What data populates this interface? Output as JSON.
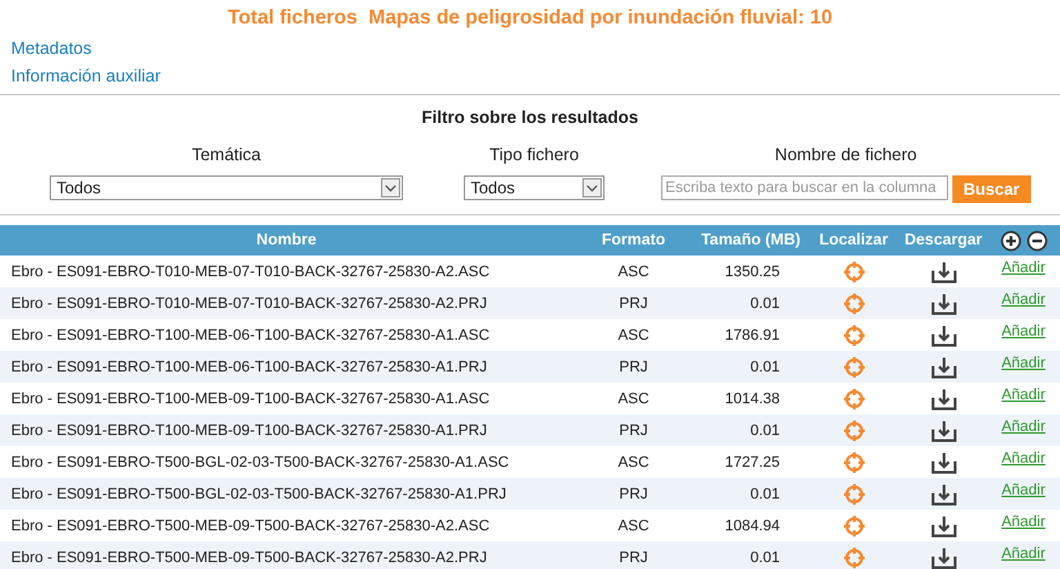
{
  "title": "Total ficheros  Mapas de peligrosidad por inundación fluvial: 10",
  "links": [
    "Metadatos",
    "Información auxiliar"
  ],
  "filter": {
    "title": "Filtro sobre los resultados",
    "fields": [
      {
        "kind": "select",
        "label": "Temática",
        "value": "Todos"
      },
      {
        "kind": "select",
        "label": "Tipo fichero",
        "value": "Todos"
      },
      {
        "kind": "search",
        "label": "Nombre de fichero",
        "placeholder": "Escriba texto para buscar en la columna",
        "button": "Buscar"
      }
    ]
  },
  "table": {
    "columns": [
      "Nombre",
      "Formato",
      "Tamaño (MB)",
      "Localizar",
      "Descargar"
    ],
    "rows": [
      {
        "name": "Ebro - ES091-EBRO-T010-MEB-07-T010-BACK-32767-25830-A2.ASC",
        "format": "ASC",
        "size": "1350.25",
        "action": "Añadir"
      },
      {
        "name": "Ebro - ES091-EBRO-T010-MEB-07-T010-BACK-32767-25830-A2.PRJ",
        "format": "PRJ",
        "size": "0.01",
        "action": "Añadir"
      },
      {
        "name": "Ebro - ES091-EBRO-T100-MEB-06-T100-BACK-32767-25830-A1.ASC",
        "format": "ASC",
        "size": "1786.91",
        "action": "Añadir"
      },
      {
        "name": "Ebro - ES091-EBRO-T100-MEB-06-T100-BACK-32767-25830-A1.PRJ",
        "format": "PRJ",
        "size": "0.01",
        "action": "Añadir"
      },
      {
        "name": "Ebro - ES091-EBRO-T100-MEB-09-T100-BACK-32767-25830-A1.ASC",
        "format": "ASC",
        "size": "1014.38",
        "action": "Añadir"
      },
      {
        "name": "Ebro - ES091-EBRO-T100-MEB-09-T100-BACK-32767-25830-A1.PRJ",
        "format": "PRJ",
        "size": "0.01",
        "action": "Añadir"
      },
      {
        "name": "Ebro - ES091-EBRO-T500-BGL-02-03-T500-BACK-32767-25830-A1.ASC",
        "format": "ASC",
        "size": "1727.25",
        "action": "Añadir"
      },
      {
        "name": "Ebro - ES091-EBRO-T500-BGL-02-03-T500-BACK-32767-25830-A1.PRJ",
        "format": "PRJ",
        "size": "0.01",
        "action": "Añadir"
      },
      {
        "name": "Ebro - ES091-EBRO-T500-MEB-09-T500-BACK-32767-25830-A2.ASC",
        "format": "ASC",
        "size": "1084.94",
        "action": "Añadir"
      },
      {
        "name": "Ebro - ES091-EBRO-T500-MEB-09-T500-BACK-32767-25830-A2.PRJ",
        "format": "PRJ",
        "size": "0.01",
        "action": "Añadir"
      }
    ]
  }
}
